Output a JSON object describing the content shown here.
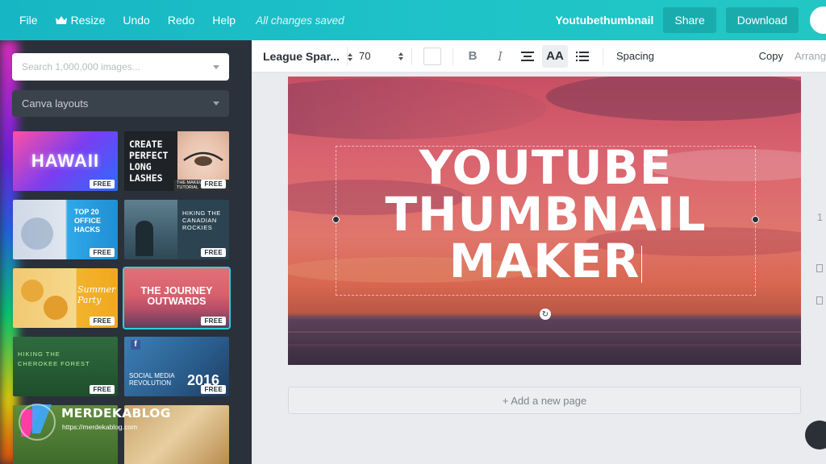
{
  "topbar": {
    "menu": [
      "File",
      "Resize",
      "Undo",
      "Redo",
      "Help"
    ],
    "saved_status": "All changes saved",
    "document_title": "Youtubethumbnail",
    "share_label": "Share",
    "download_label": "Download",
    "brand_color": "#1ec3c8"
  },
  "sidebar": {
    "search_placeholder": "Search 1,000,000 images...",
    "layouts_label": "Canva layouts",
    "tiles": [
      {
        "text": "HAWAII",
        "badge": "FREE"
      },
      {
        "text": "CREATE PERFECT LONG LASHES",
        "subtext": "THE MAKEUP TUTORIAL",
        "badge": "FREE"
      },
      {
        "text": "TOP 20 OFFICE HACKS",
        "badge": "FREE"
      },
      {
        "text": "HIKING THE CANADIAN ROCKIES",
        "badge": "FREE"
      },
      {
        "text": "Summer Party",
        "badge": "FREE"
      },
      {
        "text": "THE JOURNEY OUTWARDS",
        "badge": "FREE"
      },
      {
        "text": "HIKING THE CHEROKEE FOREST",
        "badge": "FREE"
      },
      {
        "text": "SOCIAL MEDIA REVOLUTION",
        "year": "2016",
        "badge": "FREE"
      }
    ]
  },
  "toolbar": {
    "font_name": "League Spar...",
    "font_size": "70",
    "bold_label": "B",
    "italic_label": "I",
    "case_label": "AA",
    "spacing_label": "Spacing",
    "copy_label": "Copy",
    "arrange_label": "Arrang"
  },
  "canvas": {
    "headline_lines": [
      "YOUTUBE",
      "THUMBNAIL",
      "MAKER"
    ],
    "add_page_label": "+ Add a new page",
    "side_text": "1"
  },
  "watermark": {
    "name": "MERDEKABLOG",
    "url": "https://merdekablog.com"
  }
}
